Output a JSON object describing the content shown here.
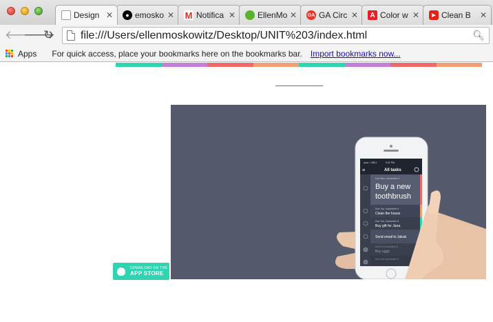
{
  "tabs": [
    {
      "title": "Design",
      "icon": "document-icon",
      "color": "#ffffff"
    },
    {
      "title": "emosko",
      "icon": "github-icon",
      "color": "#000000"
    },
    {
      "title": "Notifica",
      "icon": "gmail-icon",
      "color": "#d93025"
    },
    {
      "title": "EllenMo",
      "icon": "green-dot-icon",
      "color": "#59b32f"
    },
    {
      "title": "GA Circ",
      "icon": "ga-icon",
      "color": "#e8372d"
    },
    {
      "title": "Color w",
      "icon": "adobe-icon",
      "color": "#ee1c24"
    },
    {
      "title": "Clean B",
      "icon": "youtube-icon",
      "color": "#e62117"
    }
  ],
  "address": {
    "url": "file:///Users/ellenmoskowitz/Desktop/UNIT%203/index.html"
  },
  "bookmarks": {
    "apps_label": "Apps",
    "hint": "For quick access, place your bookmarks here on the bookmarks bar.",
    "import_link": "Import bookmarks now..."
  },
  "page": {
    "stripe_colors": [
      "#2fd4b0",
      "#c280d8",
      "#ec6a6a",
      "#f0a070",
      "#2fd4b0",
      "#c280d8",
      "#ec6a6a",
      "#f0a070"
    ],
    "hero_bg": "#545a6c",
    "phone": {
      "carrier": "BELL",
      "time": "9:41 PM",
      "header": "All tasks",
      "tasks": [
        {
          "date": "Due Mon, November 4",
          "title": "Buy a new toothbrush",
          "color": "#ec6a6a"
        },
        {
          "date": "Due Tue, November 5",
          "title": "Clean the house",
          "color": "#f0a070"
        },
        {
          "date": "Due Tue, November 6",
          "title": "Buy gift for Jana",
          "color": "#2fd4b0"
        },
        {
          "date": "",
          "title": "Send email to Jakub",
          "color": "#c280d8"
        },
        {
          "date": "Due Fri, November 8",
          "title": "Buy eggs",
          "color": "#545a6c"
        },
        {
          "date": "Due Sat, November 9",
          "title": "",
          "color": "#545a6c"
        }
      ]
    },
    "appstore": {
      "line1": "DOWNLOAD ON THE",
      "line2": "APP STORE",
      "color": "#2fd4b0"
    }
  }
}
